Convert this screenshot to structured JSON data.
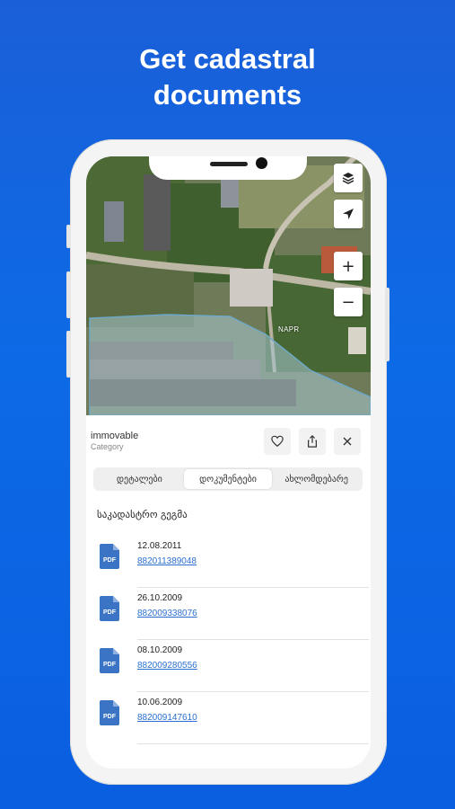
{
  "promo": {
    "title_line1": "Get cadastral",
    "title_line2": "documents"
  },
  "map": {
    "label": "NAPR",
    "controls": {
      "layers_icon": "layers-icon",
      "locate_icon": "navigation-arrow-icon",
      "zoom_in": "+",
      "zoom_out": "−"
    }
  },
  "property": {
    "type": "immovable",
    "category": "Category",
    "actions": [
      "heart-icon",
      "share-icon",
      "close-icon"
    ]
  },
  "tabs": [
    {
      "label": "დეტალები",
      "active": false
    },
    {
      "label": "დოკუმენტები",
      "active": true
    },
    {
      "label": "ახლომდებარე",
      "active": false
    }
  ],
  "documents": {
    "section_title": "საკადასტრო გეგმა",
    "items": [
      {
        "date": "12.08.2011",
        "number": "882011389048",
        "icon_label": "PDF"
      },
      {
        "date": "26.10.2009",
        "number": "882009338076",
        "icon_label": "PDF"
      },
      {
        "date": "08.10.2009",
        "number": "882009280556",
        "icon_label": "PDF"
      },
      {
        "date": "10.06.2009",
        "number": "882009147610",
        "icon_label": "PDF"
      }
    ]
  },
  "colors": {
    "background": "#0d6ae6",
    "link": "#2a6fd1",
    "pdf_icon": "#3b74c4"
  }
}
